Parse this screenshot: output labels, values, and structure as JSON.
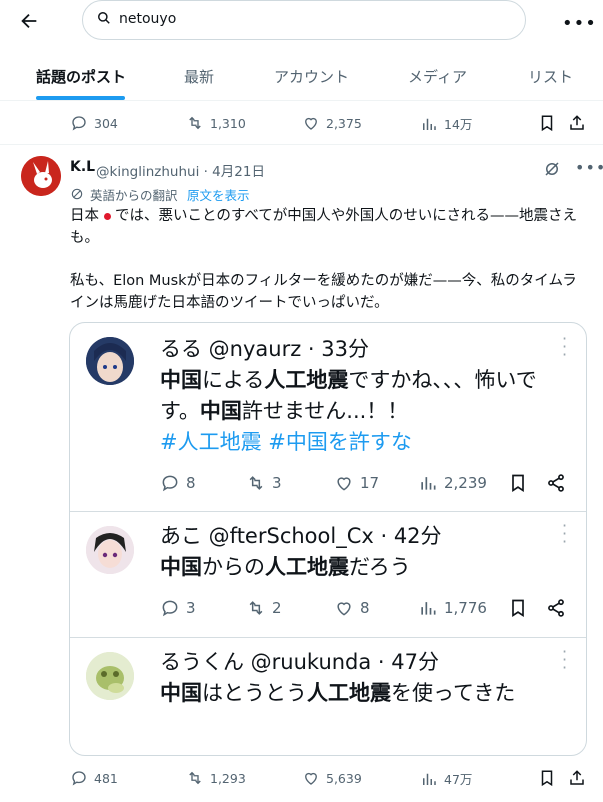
{
  "search": {
    "value": "netouyo"
  },
  "tabs": [
    {
      "label": "話題のポスト",
      "active": true
    },
    {
      "label": "最新"
    },
    {
      "label": "アカウント"
    },
    {
      "label": "メディア"
    },
    {
      "label": "リスト"
    }
  ],
  "prev_post_actions": {
    "replies": "304",
    "reposts": "1,310",
    "likes": "2,375",
    "views": "14万"
  },
  "post": {
    "name": "K.L",
    "handle_date": "@kinglinzhuhui · 4月21日",
    "translated_label": "英語からの翻訳",
    "show_original": "原文を表示",
    "text_line1a": "日本",
    "text_line1b": "では、悪いことのすべてが中国人や外国人のせいにされる——地震さえも。",
    "text_line2": "私も、Elon Muskが日本のフィルターを緩めたのが嫌だ——今、私のタイムラインは馬鹿げた日本語のツイートでいっぱいだ。",
    "actions": {
      "replies": "481",
      "reposts": "1,293",
      "likes": "5,639",
      "views": "47万"
    }
  },
  "embedded": [
    {
      "name_line": "るる @nyaurz · 33分",
      "body_a": "中国",
      "body_b": "による",
      "body_c": "人工地震",
      "body_d": "ですかね、、、怖いです。",
      "body_e": "中国",
      "body_f": "許せません...！！",
      "tags": "#人工地震 #中国を許すな",
      "replies": "8",
      "reposts": "3",
      "likes": "17",
      "views": "2,239"
    },
    {
      "name_line": "あこ @fterSchool_Cx · 42分",
      "body_a": "中国",
      "body_b": "からの",
      "body_c": "人工地震",
      "body_d": "だろう",
      "replies": "3",
      "reposts": "2",
      "likes": "8",
      "views": "1,776"
    },
    {
      "name_line": "るうくん @ruukunda · 47分",
      "body_a": "中国",
      "body_b": "はとうとう",
      "body_c": "人工地震",
      "body_d": "を使ってきた"
    }
  ],
  "colors": {
    "accent": "#1d9bf0",
    "text": "#0f1419",
    "muted": "#536471"
  }
}
